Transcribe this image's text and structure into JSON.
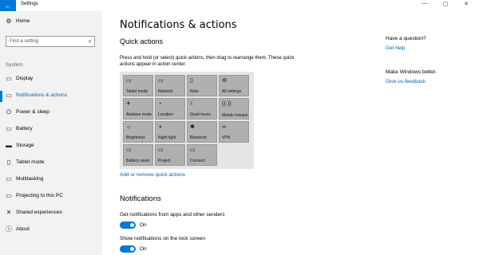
{
  "window": {
    "title": "Settings",
    "back_glyph": "←",
    "minimize_glyph": "—",
    "maximize_glyph": "▢",
    "close_glyph": "✕"
  },
  "sidebar": {
    "home_label": "Home",
    "search_placeholder": "Find a setting",
    "section_label": "System",
    "items": [
      {
        "label": "Display",
        "icon": "display-icon"
      },
      {
        "label": "Notifications & actions",
        "icon": "notifications-icon",
        "active": true
      },
      {
        "label": "Power & sleep",
        "icon": "power-icon"
      },
      {
        "label": "Battery",
        "icon": "battery-icon"
      },
      {
        "label": "Storage",
        "icon": "storage-icon"
      },
      {
        "label": "Tablet mode",
        "icon": "tablet-icon"
      },
      {
        "label": "Multitasking",
        "icon": "multitasking-icon"
      },
      {
        "label": "Projecting to this PC",
        "icon": "projecting-icon"
      },
      {
        "label": "Shared experiences",
        "icon": "shared-icon"
      },
      {
        "label": "About",
        "icon": "info-icon"
      }
    ]
  },
  "main": {
    "title": "Notifications & actions",
    "quick_actions_title": "Quick actions",
    "quick_actions_desc": "Press and hold (or select) quick actions, then drag to rearrange them. These quick actions appear in action center.",
    "tiles": [
      {
        "label": "Tablet mode",
        "icon": "tablet-icon"
      },
      {
        "label": "Network",
        "icon": "network-icon"
      },
      {
        "label": "Note",
        "icon": "note-icon"
      },
      {
        "label": "All settings",
        "icon": "settings-icon"
      },
      {
        "label": "Airplane mode",
        "icon": "airplane-icon"
      },
      {
        "label": "Location",
        "icon": "location-icon"
      },
      {
        "label": "Quiet hours",
        "icon": "moon-icon"
      },
      {
        "label": "Mobile hotspot",
        "icon": "hotspot-icon"
      },
      {
        "label": "Brightness",
        "icon": "brightness-icon"
      },
      {
        "label": "Night light",
        "icon": "night-light-icon"
      },
      {
        "label": "Bluetooth",
        "icon": "bluetooth-icon"
      },
      {
        "label": "VPN",
        "icon": "vpn-icon"
      },
      {
        "label": "Battery saver",
        "icon": "battery-saver-icon"
      },
      {
        "label": "Project",
        "icon": "project-icon"
      },
      {
        "label": "Connect",
        "icon": "connect-icon"
      }
    ],
    "add_remove_link": "Add or remove quick actions",
    "notifications_title": "Notifications",
    "setting_1_label": "Get notifications from apps and other senders",
    "setting_1_state": "On",
    "setting_2_label": "Show notifications on the lock screen",
    "setting_2_state": "On"
  },
  "aside": {
    "question": "Have a question?",
    "get_help": "Get help",
    "better": "Make Windows better.",
    "feedback": "Give us feedback"
  },
  "colors": {
    "accent": "#0078d7",
    "link": "#0063b1",
    "sidebar_bg": "#f2f2f2",
    "tile_bg": "#b0b0b0"
  }
}
